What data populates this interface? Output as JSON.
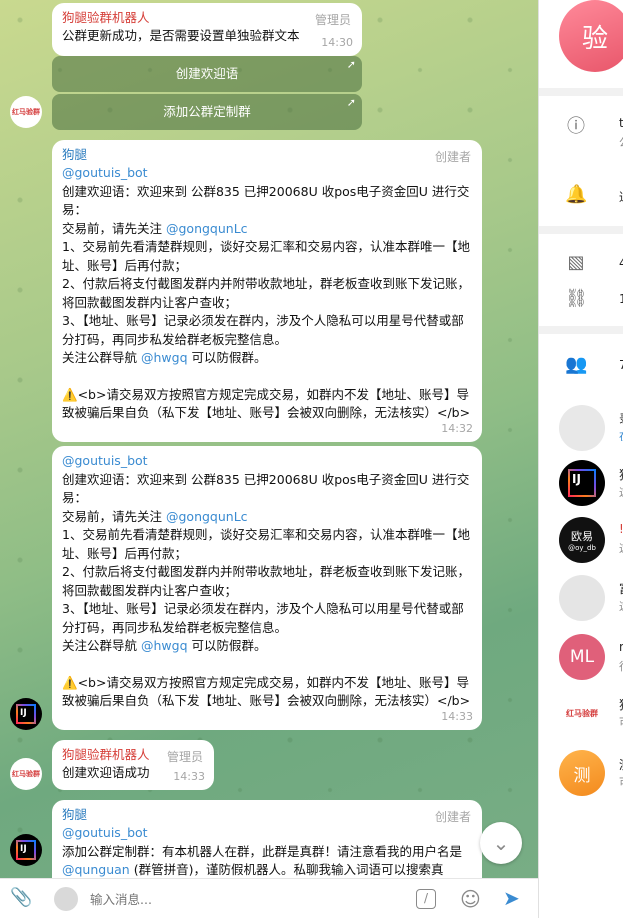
{
  "messages": {
    "m1": {
      "sender": "狗腿验群机器人",
      "role": "管理员",
      "text": "公群更新成功，是否需要设置单独验群文本",
      "time": "14:30"
    },
    "kb": {
      "b1": "创建欢迎语",
      "b2": "添加公群定制群"
    },
    "m2": {
      "sender": "狗腿",
      "handle": "@goutuis_bot",
      "role": "创建者",
      "time": "14:32"
    },
    "m3": {
      "handle": "@goutuis_bot",
      "time": "14:33"
    },
    "welcome": {
      "l1": "创建欢迎语：欢迎来到 公群835 已押20068U 收pos电子资金回U 进行交易：",
      "l2a": "交易前，请先关注 ",
      "l2b": "@gongqunLc",
      "l3": "1、交易前先看清楚群规则，谈好交易汇率和交易内容，认准本群唯一【地址、账号】后再付款；",
      "l4": "2、付款后将支付截图发群内并附带收款地址，群老板查收到账下发记账，将回款截图发群内让客户查收；",
      "l5": "3、【地址、账号】记录必须发在群内，涉及个人隐私可以用星号代替或部分打码，再同步私发给群老板完整信息。",
      "l6a": "关注公群导航 ",
      "l6b": "@hwgq",
      "l6c": " 可以防假群。",
      "l7": "⚠️<b>请交易双方按照官方规定完成交易，如群内不发【地址、账号】导致被骗后果自负（私下发【地址、账号】会被双向删除，无法核实）</b>"
    },
    "m4": {
      "sender": "狗腿验群机器人",
      "role": "管理员",
      "text": "创建欢迎语成功",
      "time": "14:33"
    },
    "m5": {
      "sender": "狗腿",
      "handle": "@goutuis_bot",
      "role": "创建者",
      "t1": "添加公群定制群：有本机器人在群，此群是真群！请注意看我的用户名是 ",
      "t2": "@qunguan",
      "t3": " (群管拼音)，谨防假机器人。私聊我输入词语可以搜索真"
    }
  },
  "avatar_label": "红马验群",
  "ij_label": "IJ",
  "input": {
    "placeholder": "输入消息..."
  },
  "right": {
    "avatar_letter": "验",
    "r1": "t",
    "r1s": "公",
    "r2": "通",
    "r3": "4",
    "r4": "1",
    "members_count": "7",
    "mem": [
      {
        "t": "录",
        "s": "在"
      },
      {
        "t": "狗",
        "s": "这"
      },
      {
        "t": "!",
        "s": "这"
      },
      {
        "t": "富",
        "s": "这"
      },
      {
        "t": "n",
        "s": "行"
      },
      {
        "t": "狗",
        "s": "可"
      },
      {
        "t": "测",
        "s": "可"
      }
    ],
    "ml": "ML",
    "ce": "测",
    "ouyi": "欧易",
    "ouyi_sub": "@oy_db"
  }
}
